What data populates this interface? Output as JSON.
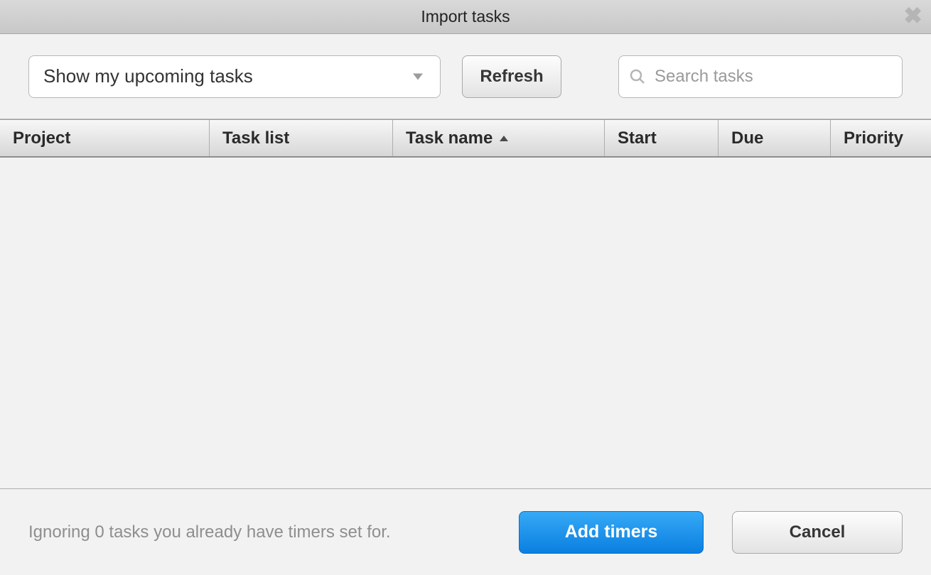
{
  "modal": {
    "title": "Import tasks"
  },
  "toolbar": {
    "filter_selected": "Show my upcoming tasks",
    "refresh_label": "Refresh",
    "search_placeholder": "Search tasks"
  },
  "columns": {
    "project": "Project",
    "tasklist": "Task list",
    "taskname": "Task name",
    "start": "Start",
    "due": "Due",
    "priority": "Priority",
    "sorted_by": "taskname",
    "sort_direction": "asc"
  },
  "rows": [],
  "footer": {
    "status": "Ignoring 0 tasks you already have timers set for.",
    "add_label": "Add timers",
    "cancel_label": "Cancel"
  }
}
